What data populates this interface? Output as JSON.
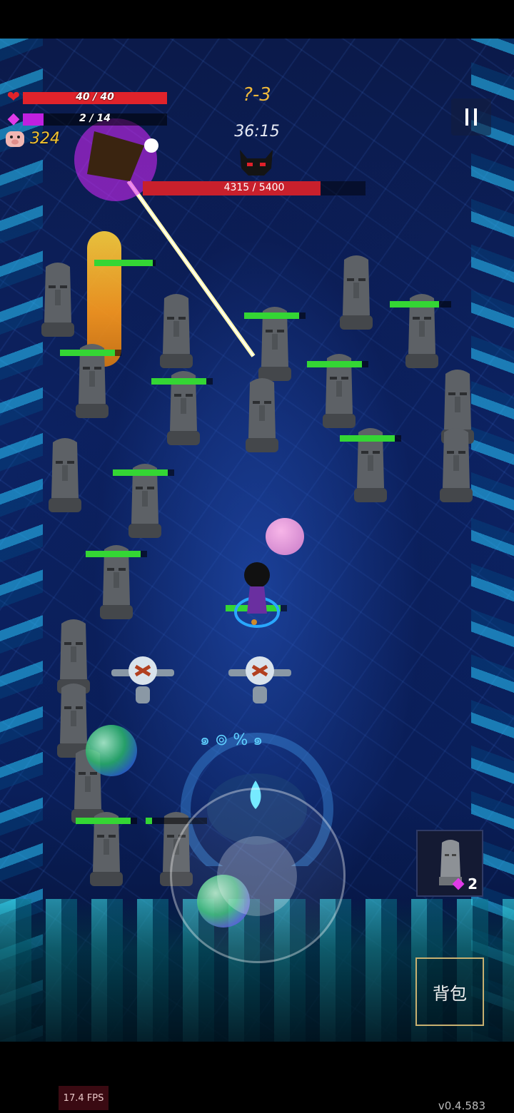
{
  "hud": {
    "hp": {
      "current": 40,
      "max": 40,
      "text": "40 / 40",
      "color": "#e0232b"
    },
    "mana": {
      "current": 2,
      "max": 14,
      "text": "2 / 14",
      "color": "#c020e0"
    },
    "coins": "324",
    "icons": {
      "hp": "heart-icon",
      "mana": "purple-gem-icon",
      "coins": "pig-icon"
    }
  },
  "stage": {
    "label": "?-3",
    "timer": "36:15"
  },
  "boss": {
    "hp_current": 4315,
    "hp_max": 5400,
    "hp_text": "4315 / 5400",
    "icon": "demon-skull-icon"
  },
  "pause": {
    "icon": "pause-icon"
  },
  "skill_slot": {
    "icon": "moai-statue-icon",
    "cost": "2",
    "cost_icon": "purple-gem-icon"
  },
  "bag": {
    "label": "背包"
  },
  "debug": {
    "fps": "17.4 FPS",
    "version": "v0.4.583"
  },
  "enemy_health": [
    0.95,
    0.9,
    0.9,
    0.9,
    0.9,
    0.9,
    0.9,
    0.9,
    0.9,
    0.9,
    0.1
  ],
  "colors": {
    "accent_gold": "#f0b93a",
    "health_green": "#34d634",
    "boss_red": "#c8202c"
  }
}
